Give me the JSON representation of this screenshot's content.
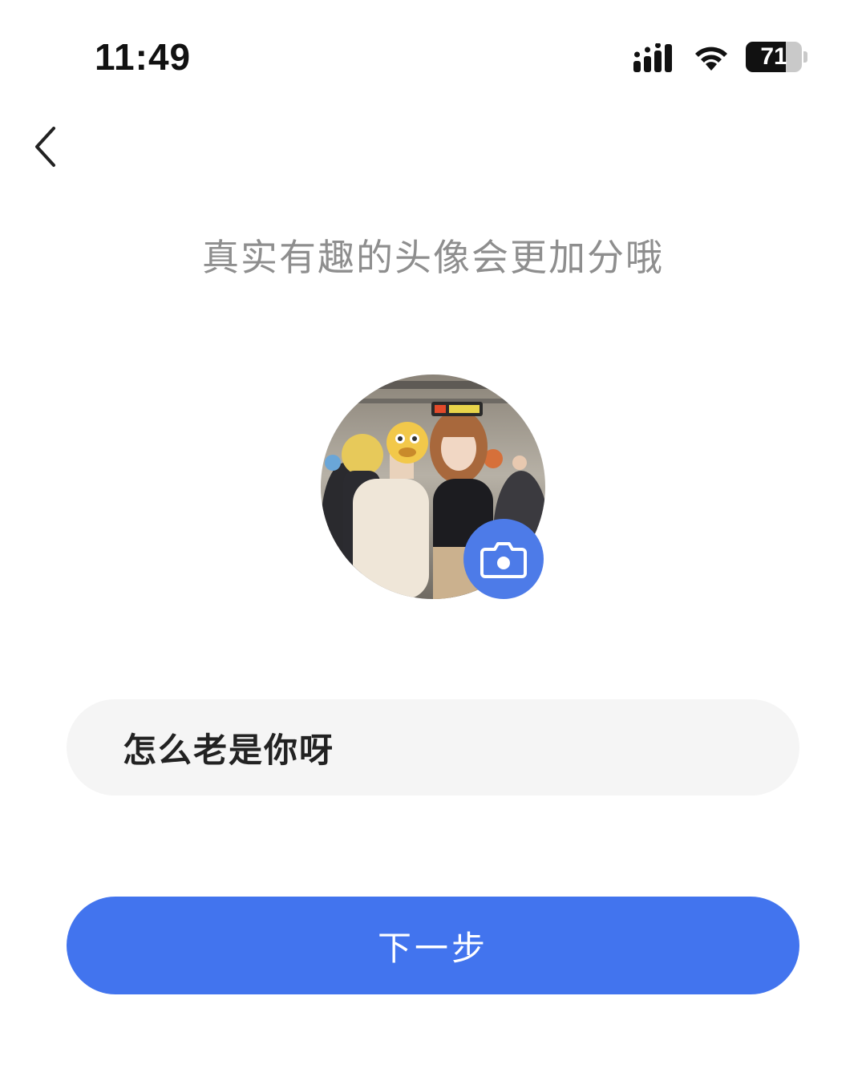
{
  "status_bar": {
    "time": "11:49",
    "battery": "71",
    "battery_level": 0.71
  },
  "nav": {
    "back_icon": "chevron-left-icon"
  },
  "title": "真实有趣的头像会更加分哦",
  "avatar": {
    "camera_icon": "camera-icon",
    "accent_color": "#4d7be8"
  },
  "nickname": {
    "value": "怎么老是你呀"
  },
  "next_button": {
    "label": "下一步",
    "color": "#4274ee"
  }
}
